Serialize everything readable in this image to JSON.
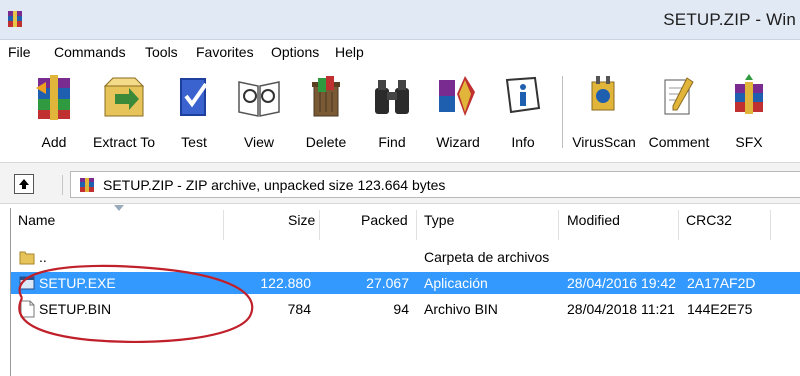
{
  "window": {
    "title": "SETUP.ZIP - Win"
  },
  "menu": [
    "File",
    "Commands",
    "Tools",
    "Favorites",
    "Options",
    "Help"
  ],
  "toolbar": {
    "add": "Add",
    "extract": "Extract To",
    "test": "Test",
    "view": "View",
    "delete": "Delete",
    "find": "Find",
    "wizard": "Wizard",
    "info": "Info",
    "virusscan": "VirusScan",
    "comment": "Comment",
    "sfx": "SFX"
  },
  "address": {
    "text": "SETUP.ZIP - ZIP archive, unpacked size 123.664 bytes"
  },
  "columns": {
    "name": "Name",
    "size": "Size",
    "packed": "Packed",
    "type": "Type",
    "modified": "Modified",
    "crc": "CRC32"
  },
  "files": [
    {
      "name": "..",
      "size": "",
      "packed": "",
      "type": "Carpeta de archivos",
      "modified": "",
      "crc": "",
      "icon": "folder-icon"
    },
    {
      "name": "SETUP.EXE",
      "size": "122.880",
      "packed": "27.067",
      "type": "Aplicación",
      "modified": "28/04/2016 19:42",
      "crc": "2A17AF2D",
      "icon": "exe-icon",
      "selected": true
    },
    {
      "name": "SETUP.BIN",
      "size": "784",
      "packed": "94",
      "type": "Archivo BIN",
      "modified": "28/04/2018 11:21",
      "crc": "144E2E75",
      "icon": "file-icon"
    }
  ],
  "colors": {
    "selection": "#3399ff",
    "annotation": "#c0202a",
    "titlebar": "#e1e9f4"
  }
}
